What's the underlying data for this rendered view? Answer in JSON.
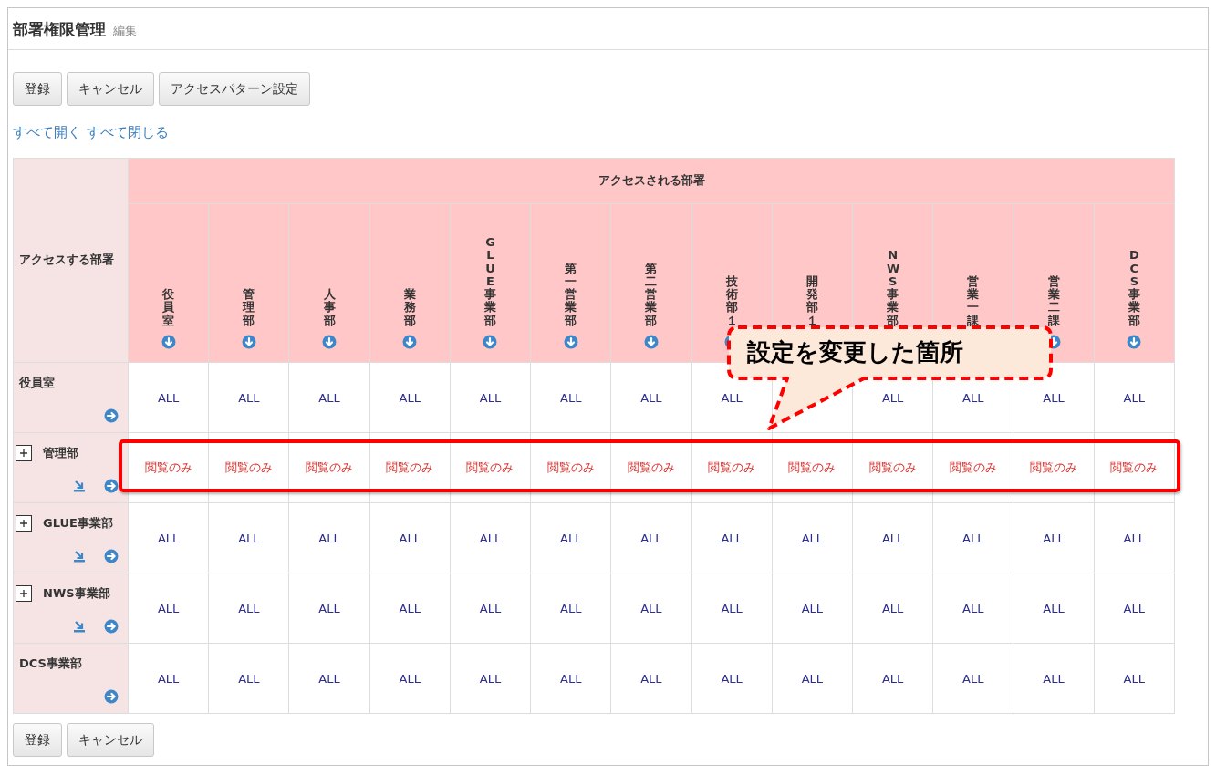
{
  "header": {
    "title": "部署権限管理",
    "subtitle": "編集"
  },
  "buttons": [
    "登録",
    "キャンセル",
    "アクセスパターン設定"
  ],
  "links": [
    "すべて開く",
    "すべて閉じる"
  ],
  "table": {
    "corner_label": "アクセスする部署",
    "group_heading": "アクセスされる部署",
    "columns": [
      {
        "label": "役員室"
      },
      {
        "label": "管理部"
      },
      {
        "label": "人事部"
      },
      {
        "label": "業務部"
      },
      {
        "label": "GLUE事業部"
      },
      {
        "label": "第一営業部"
      },
      {
        "label": "第二営業部"
      },
      {
        "label": "技術部１"
      },
      {
        "label": "開発部１"
      },
      {
        "label": "NWS事業部"
      },
      {
        "label": "営業一課"
      },
      {
        "label": "営業二課"
      },
      {
        "label": "DCS事業部"
      }
    ],
    "rows": [
      {
        "name": "役員室",
        "expandable": false,
        "kind": "all",
        "highlighted": false,
        "cells": [
          "ALL",
          "ALL",
          "ALL",
          "ALL",
          "ALL",
          "ALL",
          "ALL",
          "ALL",
          null,
          "ALL",
          "ALL",
          "ALL",
          "ALL"
        ]
      },
      {
        "name": "管理部",
        "expandable": true,
        "kind": "read",
        "highlighted": true,
        "cells": [
          "閲覧のみ",
          "閲覧のみ",
          "閲覧のみ",
          "閲覧のみ",
          "閲覧のみ",
          "閲覧のみ",
          "閲覧のみ",
          "閲覧のみ",
          "閲覧のみ",
          "閲覧のみ",
          "閲覧のみ",
          "閲覧のみ",
          "閲覧のみ"
        ]
      },
      {
        "name": "GLUE事業部",
        "expandable": true,
        "kind": "all",
        "highlighted": false,
        "cells": [
          "ALL",
          "ALL",
          "ALL",
          "ALL",
          "ALL",
          "ALL",
          "ALL",
          "ALL",
          "ALL",
          "ALL",
          "ALL",
          "ALL",
          "ALL"
        ]
      },
      {
        "name": "NWS事業部",
        "expandable": true,
        "kind": "all",
        "highlighted": false,
        "cells": [
          "ALL",
          "ALL",
          "ALL",
          "ALL",
          "ALL",
          "ALL",
          "ALL",
          "ALL",
          "ALL",
          "ALL",
          "ALL",
          "ALL",
          "ALL"
        ]
      },
      {
        "name": "DCS事業部",
        "expandable": false,
        "kind": "all",
        "highlighted": false,
        "cells": [
          "ALL",
          "ALL",
          "ALL",
          "ALL",
          "ALL",
          "ALL",
          "ALL",
          "ALL",
          "ALL",
          "ALL",
          "ALL",
          "ALL",
          "ALL"
        ]
      }
    ]
  },
  "callout": {
    "text": "設定を変更した箇所"
  },
  "bottom_buttons": [
    "登録",
    "キャンセル"
  ]
}
